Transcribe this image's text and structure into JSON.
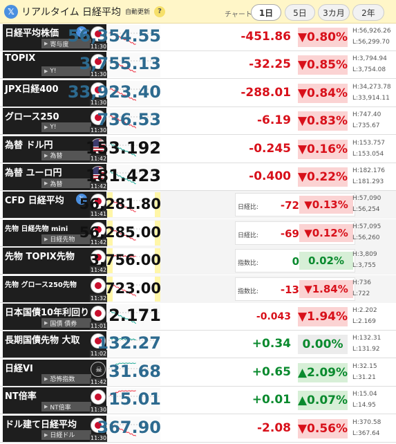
{
  "header": {
    "x_icon": "x-logo-icon",
    "title": "リアルタイム 日経平均",
    "auto_update": "自動更新",
    "help": "?",
    "chart_label": "チャート:",
    "ranges": [
      "1日",
      "5日",
      "3カ月",
      "2年"
    ],
    "selected_range": "1日"
  },
  "rows": [
    {
      "name": "日経平均株価",
      "tag": "寄与度",
      "time": "11:30",
      "price": "56,354.55",
      "change": "-451.86",
      "pct": "▼0.80%",
      "high": "H:56,926.26",
      "low": "L:56,299.70",
      "dir": "down"
    },
    {
      "name": "TOPIX",
      "tag": "Y!",
      "time": "11:30",
      "price": "3,755.13",
      "change": "-32.25",
      "pct": "▼0.85%",
      "high": "H:3,794.94",
      "low": "L:3,754.08",
      "dir": "down"
    },
    {
      "name": "JPX日経400",
      "tag": "",
      "time": "11:30",
      "price": "33,923.40",
      "change": "-288.01",
      "pct": "▼0.84%",
      "high": "H:34,273.78",
      "low": "L:33,914.11",
      "dir": "down"
    },
    {
      "name": "グロース250",
      "tag": "Y!",
      "time": "11:30",
      "price": "736.53",
      "change": "-6.19",
      "pct": "▼0.83%",
      "high": "H:747.40",
      "low": "L:735.67",
      "dir": "down"
    },
    {
      "name": "為替 ドル円",
      "tag": "為替",
      "time": "11:42",
      "price": "153.192",
      "change": "-0.245",
      "pct": "▼0.16%",
      "high": "H:153.757",
      "low": "L:153.054",
      "dir": "down"
    },
    {
      "name": "為替 ユーロ円",
      "tag": "為替",
      "time": "11:42",
      "price": "181.423",
      "change": "-0.400",
      "pct": "▼0.22%",
      "high": "H:182.176",
      "low": "L:181.293",
      "dir": "down"
    },
    {
      "name": "CFD 日経平均",
      "tag": "",
      "time": "11:41",
      "price": "56,281.80",
      "cmp_label": "日経比:",
      "cmp_val": "-72",
      "cmp_pct": "▼0.13%",
      "high": "H:57,090",
      "low": "L:56,254",
      "dir": "down"
    },
    {
      "name": "先物 日経先物 mini",
      "tag": "日経先物",
      "time": "11:42",
      "price": "56,285.00",
      "cmp_label": "日経比:",
      "cmp_val": "-69",
      "cmp_pct": "▼0.12%",
      "high": "H:57,095",
      "low": "L:56,260",
      "dir": "down"
    },
    {
      "name": "先物 TOPIX先物",
      "tag": "",
      "time": "11:42",
      "price": "3,756.00",
      "cmp_label": "指数比:",
      "cmp_val": "0",
      "cmp_pct": "0.02%",
      "high": "H:3,809",
      "low": "L:3,755",
      "dir": "flat"
    },
    {
      "name": "先物 グロース250先物",
      "tag": "",
      "time": "11:32",
      "price": "723.00",
      "cmp_label": "指数比:",
      "cmp_val": "-13",
      "cmp_pct": "▼1.84%",
      "high": "H:736",
      "low": "L:722",
      "dir": "down"
    },
    {
      "name": "日本国債10年利回り",
      "tag": "国債 債券",
      "time": "11:01",
      "price": "2.171",
      "change": "-0.043",
      "pct": "▼1.94%",
      "high": "H:2.202",
      "low": "L:2.169",
      "dir": "down"
    },
    {
      "name": "長期国債先物 大取",
      "tag": "",
      "time": "11:02",
      "price": "132.27",
      "change": "+0.34",
      "pct": "0.00%",
      "high": "H:132.31",
      "low": "L:131.92",
      "dir": "flat"
    },
    {
      "name": "日経VI",
      "tag": "恐怖指数",
      "time": "11:42",
      "price": "31.68",
      "change": "+0.65",
      "pct": "▲2.09%",
      "high": "H:32.15",
      "low": "L:31.21",
      "dir": "up"
    },
    {
      "name": "NT倍率",
      "tag": "NT倍率",
      "time": "11:30",
      "price": "15.01",
      "change": "+0.01",
      "pct": "▲0.07%",
      "high": "H:15.04",
      "low": "L:14.95",
      "dir": "up"
    },
    {
      "name": "ドル建て日経平均",
      "tag": "日経ドル",
      "time": "11:30",
      "price": "367.90",
      "change": "-2.08",
      "pct": "▼0.56%",
      "high": "H:370.58",
      "low": "L:367.64",
      "dir": "down"
    }
  ]
}
